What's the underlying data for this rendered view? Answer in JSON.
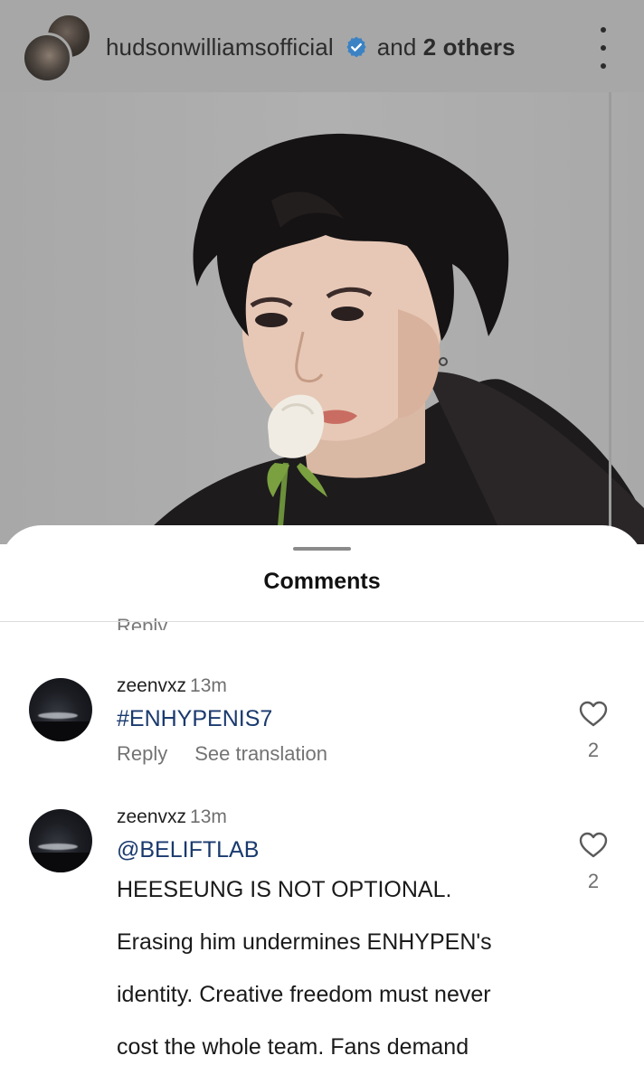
{
  "header": {
    "username": "hudsonwilliamsofficial",
    "and_text": "and",
    "others_text": "2 others",
    "verified_color": "#3b82c4"
  },
  "sheet": {
    "title": "Comments",
    "cut_reply": "Reply"
  },
  "comments": [
    {
      "username": "zeenvxz",
      "time": "13m",
      "text": "#ENHYPENIS7",
      "reply_label": "Reply",
      "translation_label": "See translation",
      "likes": "2"
    },
    {
      "username": "zeenvxz",
      "time": "13m",
      "mention": "@BELIFTLAB",
      "lines": [
        "HEESEUNG IS NOT OPTIONAL.",
        "Erasing him undermines ENHYPEN's",
        "identity. Creative freedom must never",
        "cost the whole team. Fans demand"
      ],
      "likes": "2"
    }
  ],
  "colors": {
    "link": "#1a3a6e",
    "header_bg": "#a7a7a7",
    "muted": "#737373"
  }
}
